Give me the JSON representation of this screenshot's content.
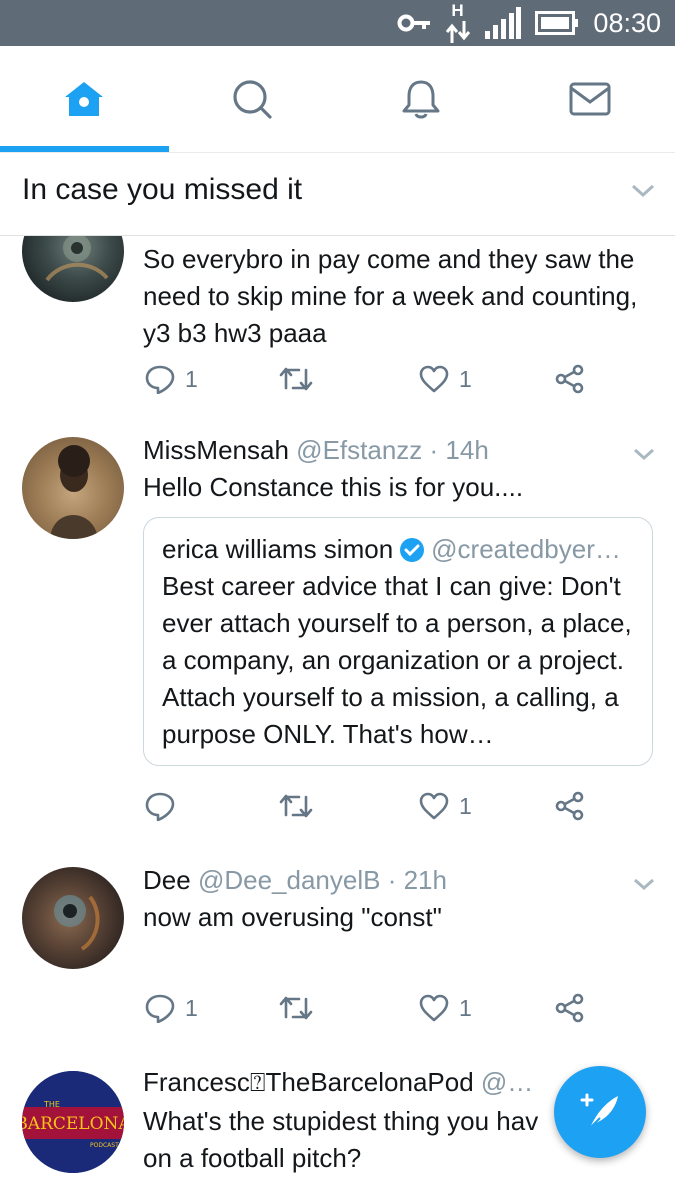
{
  "status_bar": {
    "time": "08:30",
    "network_label": "H"
  },
  "nav": {
    "tabs": [
      {
        "name": "home",
        "icon": "home-icon",
        "active": true
      },
      {
        "name": "search",
        "icon": "search-icon",
        "active": false
      },
      {
        "name": "notifications",
        "icon": "bell-icon",
        "active": false
      },
      {
        "name": "messages",
        "icon": "envelope-icon",
        "active": false
      }
    ],
    "accent_color": "#1da1f2"
  },
  "section": {
    "title": "In case you missed it"
  },
  "tweets": [
    {
      "text": "So everybro in pay come and they saw the need to skip mine for a week and counting, y3 b3 hw3 paaa",
      "replies": "1",
      "likes": "1"
    },
    {
      "name": "MissMensah",
      "handle": "@Efstanzz",
      "dot": "·",
      "age": "14h",
      "text": "Hello Constance this is for you....",
      "quote": {
        "name": "erica williams simon",
        "handle": "@createdbyer…",
        "text": "Best career advice that I can give: Don't ever attach yourself to a person, a place, a company, an organization or a project. Attach yourself to a mission, a calling, a purpose ONLY. That's how…"
      },
      "likes": "1"
    },
    {
      "name": "Dee",
      "handle": "@Dee_danyelB",
      "dot": "·",
      "age": "21h",
      "text": "now am overusing \"const\"",
      "replies": "1",
      "likes": "1"
    },
    {
      "name": "Francesc⍰TheBarcelonaPod",
      "handle": "@…",
      "text": "What's the stupidest thing you hav",
      "text2": "on a football pitch?",
      "avatar_logo": "THE BARCELONA PODCAST"
    }
  ],
  "fab": {
    "icon": "compose-icon"
  }
}
